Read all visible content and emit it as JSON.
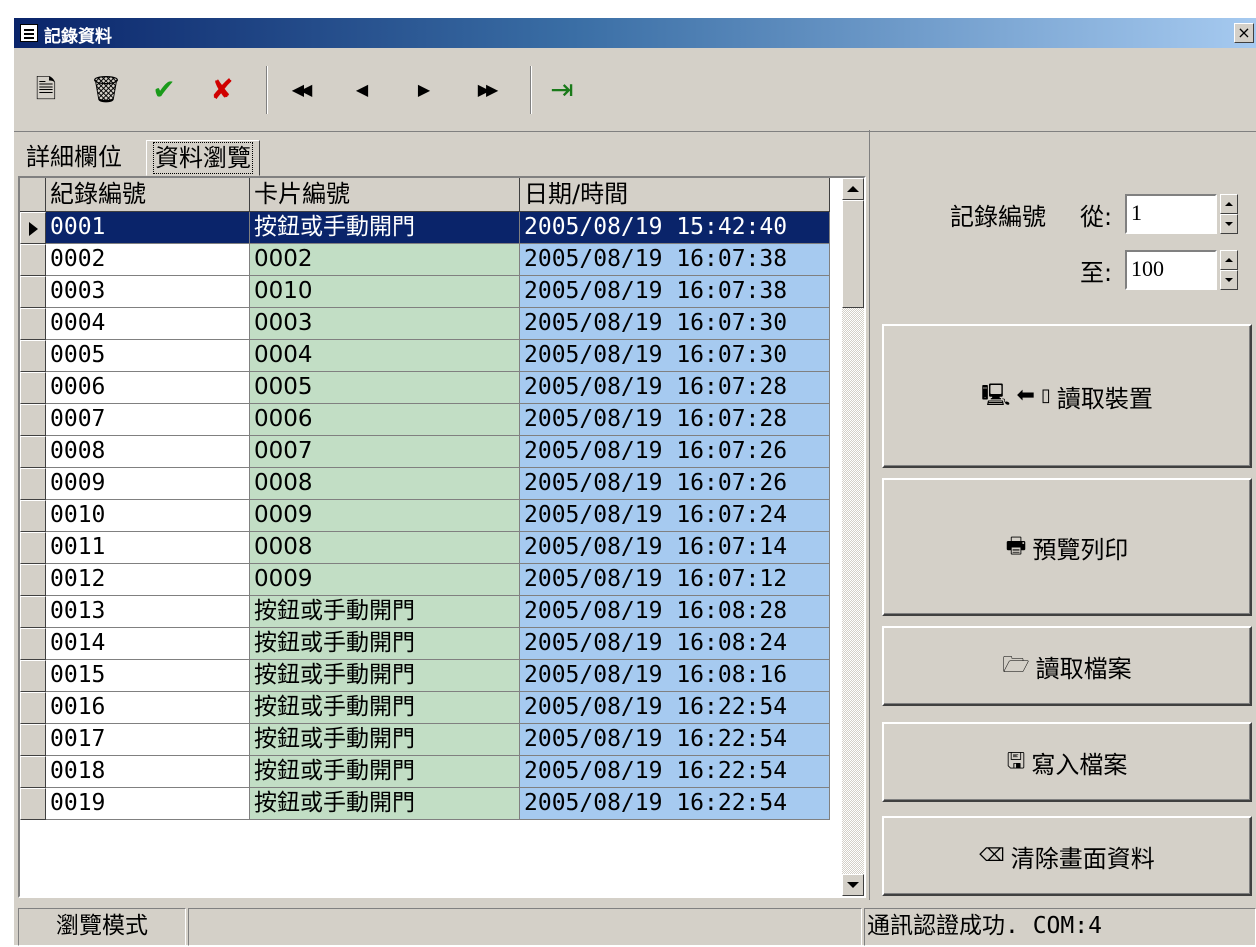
{
  "window": {
    "title": "記錄資料",
    "close_label": "×"
  },
  "toolbar": {
    "buttons": [
      {
        "name": "new-record-icon",
        "glyph": "🗎"
      },
      {
        "name": "delete-icon",
        "glyph": "🗑"
      },
      {
        "name": "confirm-icon",
        "glyph": "✔"
      },
      {
        "name": "cancel-icon",
        "glyph": "✘"
      },
      {
        "name": "first-record-icon",
        "glyph": "◀◀"
      },
      {
        "name": "prev-record-icon",
        "glyph": "◀"
      },
      {
        "name": "next-record-icon",
        "glyph": "▶"
      },
      {
        "name": "last-record-icon",
        "glyph": "▶▶"
      },
      {
        "name": "exit-icon",
        "glyph": "⇥"
      }
    ]
  },
  "tabs": [
    {
      "label": "詳細欄位"
    },
    {
      "label": "資料瀏覽"
    }
  ],
  "grid": {
    "headers": [
      "紀錄編號",
      "卡片編號",
      "日期/時間"
    ],
    "rows": [
      [
        "0001",
        "按鈕或手動開門",
        "2005/08/19  15:42:40"
      ],
      [
        "0002",
        "0002",
        "2005/08/19  16:07:38"
      ],
      [
        "0003",
        "0010",
        "2005/08/19  16:07:38"
      ],
      [
        "0004",
        "0003",
        "2005/08/19  16:07:30"
      ],
      [
        "0005",
        "0004",
        "2005/08/19  16:07:30"
      ],
      [
        "0006",
        "0005",
        "2005/08/19  16:07:28"
      ],
      [
        "0007",
        "0006",
        "2005/08/19  16:07:28"
      ],
      [
        "0008",
        "0007",
        "2005/08/19  16:07:26"
      ],
      [
        "0009",
        "0008",
        "2005/08/19  16:07:26"
      ],
      [
        "0010",
        "0009",
        "2005/08/19  16:07:24"
      ],
      [
        "0011",
        "0008",
        "2005/08/19  16:07:14"
      ],
      [
        "0012",
        "0009",
        "2005/08/19  16:07:12"
      ],
      [
        "0013",
        "按鈕或手動開門",
        "2005/08/19  16:08:28"
      ],
      [
        "0014",
        "按鈕或手動開門",
        "2005/08/19  16:08:24"
      ],
      [
        "0015",
        "按鈕或手動開門",
        "2005/08/19  16:08:16"
      ],
      [
        "0016",
        "按鈕或手動開門",
        "2005/08/19  16:22:54"
      ],
      [
        "0017",
        "按鈕或手動開門",
        "2005/08/19  16:22:54"
      ],
      [
        "0018",
        "按鈕或手動開門",
        "2005/08/19  16:22:54"
      ],
      [
        "0019",
        "按鈕或手動開門",
        "2005/08/19  16:22:54"
      ]
    ]
  },
  "range": {
    "label": "記錄編號",
    "from_label": "從:",
    "from_value": "1",
    "to_label": "至:",
    "to_value": "100"
  },
  "actions": {
    "read_device": {
      "label": "讀取裝置",
      "icon": "computer-arrow-device"
    },
    "preview_print": {
      "label": "預覽列印",
      "icon": "printer-icon"
    },
    "read_file": {
      "label": "讀取檔案",
      "icon": "open-file-icon"
    },
    "write_file": {
      "label": "寫入檔案",
      "icon": "floppy-disk-icon"
    },
    "clear_screen": {
      "label": "清除畫面資料",
      "icon": "eraser-icon"
    }
  },
  "status": {
    "mode": "瀏覽模式",
    "middle": "",
    "message": "通訊認證成功.  COM:4"
  },
  "colors": {
    "title_start": "#0a246a",
    "title_end": "#a6caf0",
    "card_column_bg": "#c2dec5",
    "date_column_bg": "#a6caf0",
    "selected_row": "#0a246a",
    "face": "#d4d0c8"
  }
}
